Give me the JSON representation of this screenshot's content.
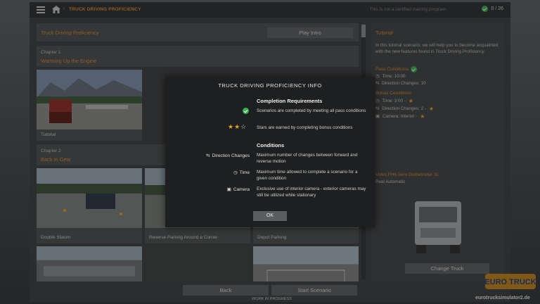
{
  "topbar": {
    "breadcrumb": "TRUCK DRIVING PROFICIENCY",
    "not_certified": "This is not a certified training program.",
    "progress": "0 / 26"
  },
  "left": {
    "header_title": "Truck Driving Proficiency",
    "play_intro": "Play Intro",
    "chapters": [
      {
        "num": "Chapter 1",
        "name": "Warming Up the Engine"
      },
      {
        "num": "Chapter 2",
        "name": "Back in Gear"
      }
    ],
    "cards": [
      "Tutorial",
      "Double Slalom",
      "Reverse Parking Around a Corner",
      "Depot Parking"
    ]
  },
  "right": {
    "title": "Tutorial",
    "intro": "In this tutorial scenario, we will help you to become acquainted with the new features found in Truck Driving Proficiency.",
    "pass_title": "Pass Conditions",
    "pass_time": "Time: 10:00",
    "pass_dir": "Direction Changes: 10",
    "bonus_title": "Bonus Conditions",
    "bonus_time": "Time: 3:00 -",
    "bonus_dir": "Direction Changes: 2 -",
    "bonus_cam": "Camera: Interior -",
    "truck_name": "Volvo FH6 Aero Globetrotter XL",
    "truck_type": "Real Automatic",
    "change_truck": "Change Truck"
  },
  "bottom": {
    "back": "Back",
    "start": "Start Scenario",
    "wip": "WORK IN PROGRESS",
    "watermark": "eurotrucksimulator2.de"
  },
  "modal": {
    "title": "TRUCK DRIVING PROFICIENCY INFO",
    "completion_head": "Completion Requirements",
    "req1": "Scenarios are completed by meeting all pass conditions",
    "req2": "Stars are earned by completing bonus conditions",
    "conditions_head": "Conditions",
    "cond1_label": "Direction Changes",
    "cond1_text": "Maximum number of changes between forward and reverse motion",
    "cond2_label": "Time",
    "cond2_text": "Maximum time allowed to complete a scenario for a given condition",
    "cond3_label": "Camera",
    "cond3_text": "Exclusive use of interior camera - exterior cameras may still be utilized while stationary",
    "ok": "OK"
  },
  "colors": {
    "accent": "#d98a2a",
    "success": "#3ab34a",
    "star": "#e7a21d"
  }
}
